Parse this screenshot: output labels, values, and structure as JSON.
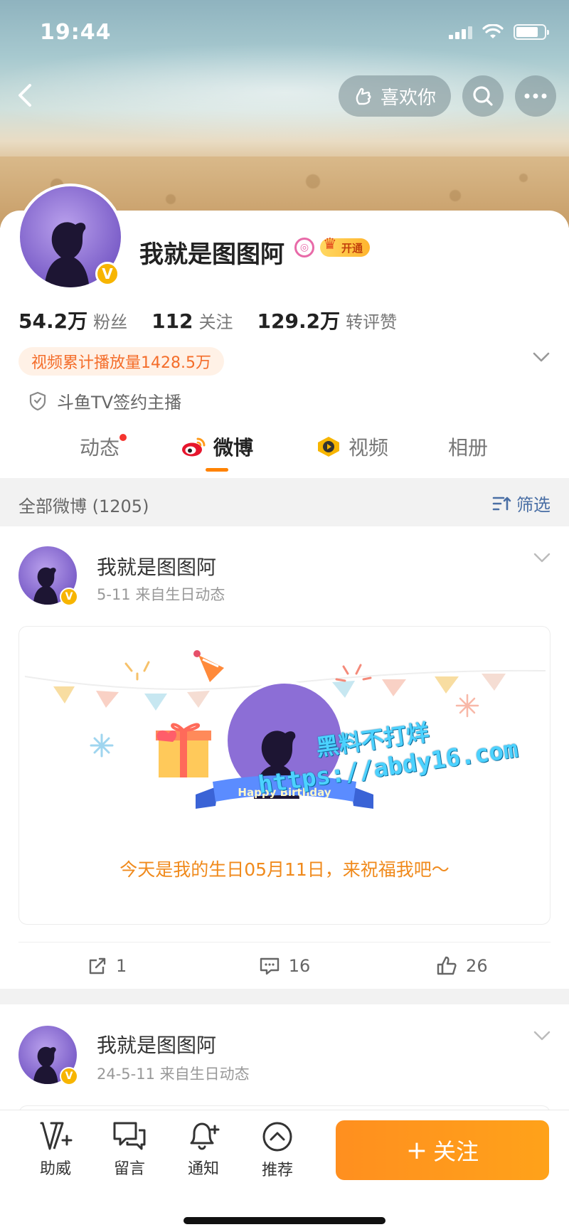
{
  "status_bar": {
    "time": "19:44"
  },
  "nav": {
    "like_label": "喜欢你"
  },
  "profile": {
    "name": "我就是图图阿",
    "vip_label": "开通",
    "stats": [
      {
        "value": "54.2万",
        "label": "粉丝"
      },
      {
        "value": "112",
        "label": "关注"
      },
      {
        "value": "129.2万",
        "label": "转评赞"
      }
    ],
    "play_count": "视频累计播放量1428.5万",
    "verification": "斗鱼TV签约主播"
  },
  "tabs": [
    {
      "label": "动态",
      "has_dot": true
    },
    {
      "label": "微博",
      "active": true
    },
    {
      "label": "视频"
    },
    {
      "label": "相册"
    }
  ],
  "feed": {
    "count_label": "全部微博 (1205)",
    "filter_label": "筛选"
  },
  "posts": [
    {
      "author": "我就是图图阿",
      "meta": "5-11  来自生日动态",
      "birthday_banner": "Happy Birthday",
      "birthday_message": "今天是我的生日05月11日，来祝福我吧～",
      "reposts": "1",
      "comments": "16",
      "likes": "26"
    },
    {
      "author": "我就是图图阿",
      "meta": "24-5-11  来自生日动态"
    }
  ],
  "watermark": {
    "line1": "黑料不打烊",
    "line2": "https://abdy16.com"
  },
  "bottom_bar": {
    "items": [
      "助威",
      "留言",
      "通知",
      "推荐"
    ],
    "follow_label": "关注"
  },
  "colors": {
    "accent": "#ff8200",
    "follow_button": "#ff9a1e",
    "verified_badge": "#f7b500",
    "tab_dot": "#f5342e"
  }
}
